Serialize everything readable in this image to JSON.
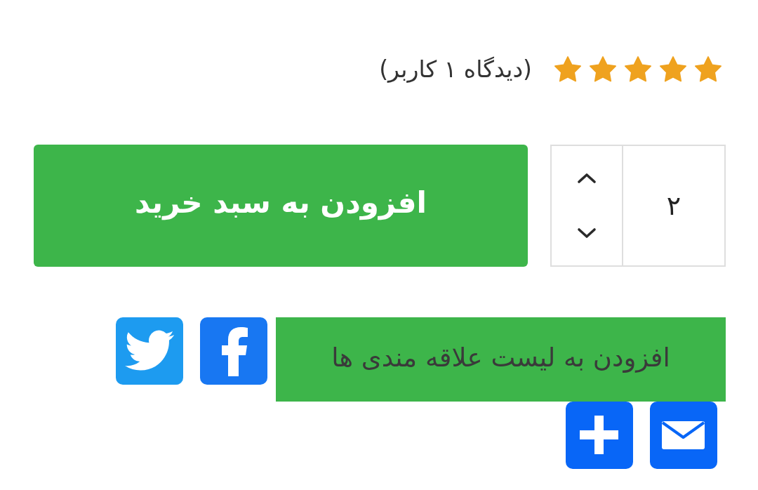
{
  "rating": {
    "stars": 5,
    "reviews": "(دیدگاه ۱ کاربر)"
  },
  "cart": {
    "quantity": "۲",
    "add_button": "افزودن به سبد خرید"
  },
  "wishlist": {
    "label": "افزودن به لیست علاقه مندی ها"
  }
}
